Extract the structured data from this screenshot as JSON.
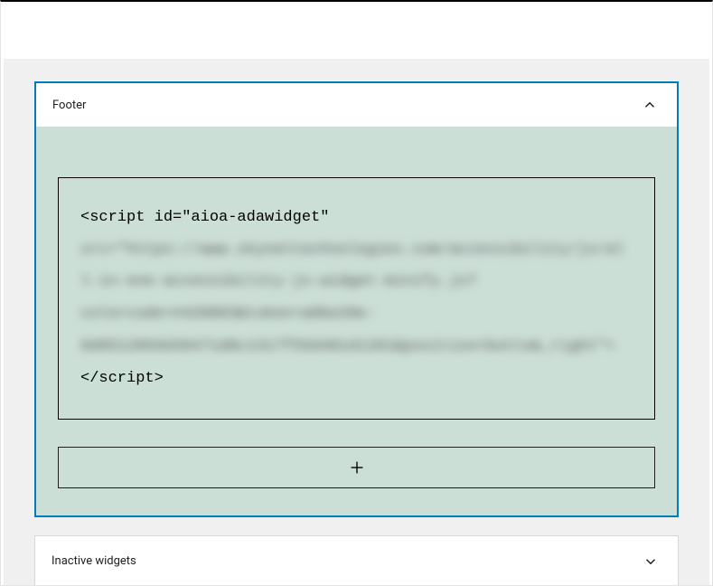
{
  "colors": {
    "accent": "#007cba",
    "body_bg": "#ccdfd7",
    "page_bg": "#f0f0f1"
  },
  "panels": {
    "footer": {
      "title": "Footer",
      "expanded": true,
      "code": {
        "line1": "<script id=\"aioa-adawidget\"",
        "line2_blurred": "src=\"https://www.skynettechnologies.com/accessibility/js/all-in-one-accessibility-js-widget-minify.js?colorcode=#420083&token=a0be20e-8d8512059d39471d0c1317f55d401d1281&position=bottom_right\">",
        "line3": "</script>"
      },
      "add_button_label": "+"
    },
    "inactive": {
      "title": "Inactive widgets",
      "expanded": false
    }
  }
}
